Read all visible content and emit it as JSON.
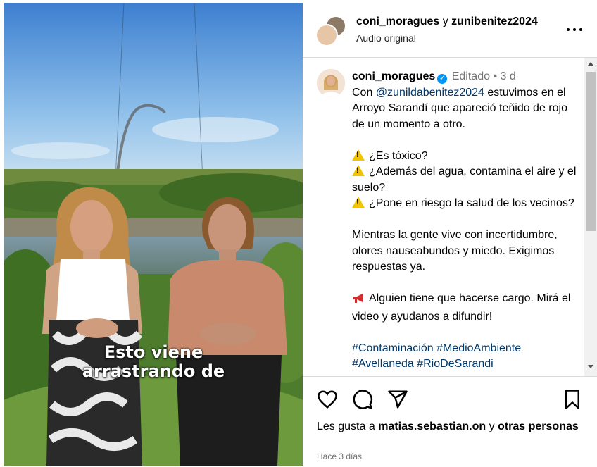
{
  "post": {
    "header": {
      "user_primary": "coni_moragues",
      "connector": "y",
      "user_secondary": "zunibenitez2024",
      "audio": "Audio original"
    },
    "video": {
      "caption_line1": "Esto viene",
      "caption_line2": "arrastrando de"
    },
    "comment": {
      "username": "coni_moragues",
      "edited": "Editado",
      "separator": "•",
      "age": "3 d",
      "intro_prefix": "Con",
      "mention": "@zunildabenitez2024",
      "intro_rest": "estuvimos en el Arroyo Sarandí que apareció teñido de rojo de un momento a otro.",
      "questions": [
        "¿Es tóxico?",
        "¿Además del agua, contamina el aire y el suelo?",
        "¿Pone en riesgo la salud de los vecinos?"
      ],
      "paragraph2": "Mientras la gente vive con incertidumbre, olores nauseabundos y miedo. Exigimos respuestas ya.",
      "paragraph3": "Alguien tiene que hacerse cargo. Mirá el video y ayudanos a difundir!",
      "hashtags_line1": "#Contaminación #MedioAmbiente",
      "hashtags_line2": "#Avellaneda #RioDeSarandi"
    },
    "likes": {
      "prefix": "Les gusta a",
      "user": "matias.sebastian.on",
      "connector": "y",
      "rest": "otras personas"
    },
    "timestamp": "Hace 3 días"
  },
  "colors": {
    "link": "#00376b",
    "verified": "#0095f6",
    "muted": "#737373"
  },
  "icons": [
    "more-options-icon",
    "verified-badge-icon",
    "warning-icon",
    "megaphone-icon",
    "heart-icon",
    "comment-icon",
    "share-icon",
    "bookmark-icon"
  ]
}
